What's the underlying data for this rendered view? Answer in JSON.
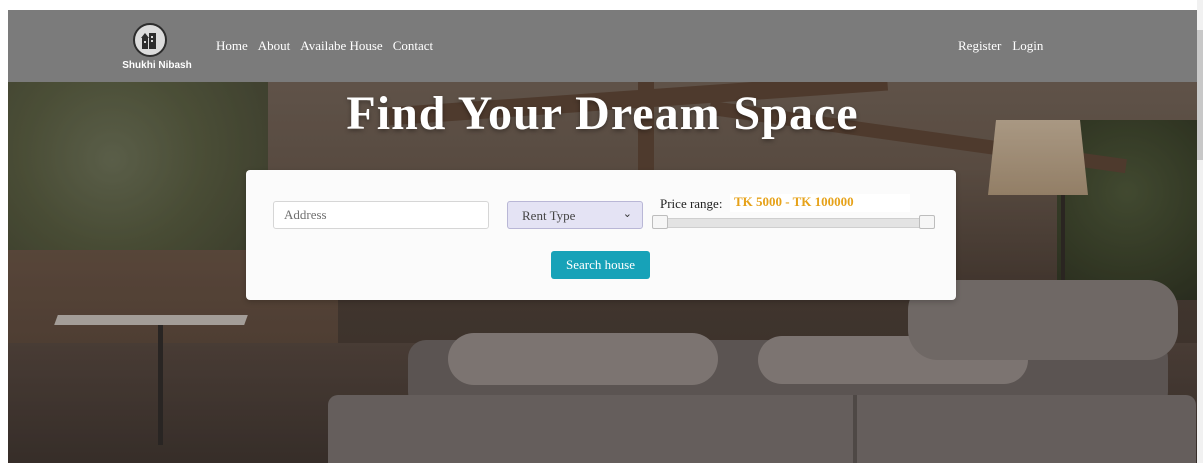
{
  "brand": {
    "logo_text": "Shukhi Nibash"
  },
  "nav": {
    "links": [
      "Home",
      "About",
      "Availabe House",
      "Contact"
    ],
    "right_links": [
      "Register",
      "Login"
    ]
  },
  "hero": {
    "title": "Find Your Dream Space"
  },
  "search": {
    "address_placeholder": "Address",
    "rent_type_selected": "Rent Type",
    "price_label": "Price range:",
    "price_value": "TK 5000 - TK 100000",
    "price_min_fraction": 0.0,
    "price_max_fraction": 1.0,
    "button_label": "Search house"
  },
  "colors": {
    "navbar": "#7b7b7b",
    "accent_button": "#17a2b8",
    "price_text": "#e6a21a"
  },
  "icons": [
    "house-logo-icon",
    "chevron-down-icon"
  ]
}
